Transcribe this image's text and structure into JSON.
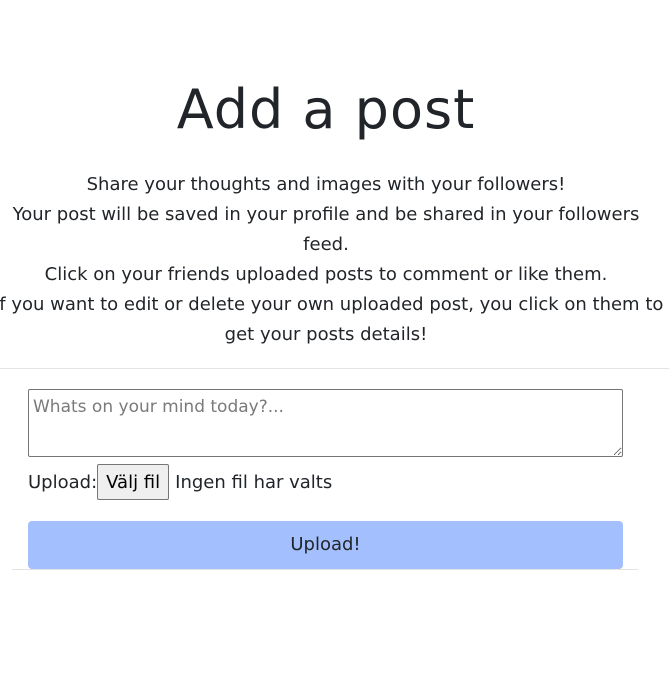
{
  "header": {
    "title": "Add a post"
  },
  "intro": {
    "lines": [
      "Share your thoughts and images with your followers!",
      "Your post will be saved in your profile and be shared in your followers",
      "feed.",
      "Click on your friends uploaded posts to comment or like them.",
      "If you want to edit or delete your own uploaded post, you click on them to",
      "get your posts details!"
    ]
  },
  "form": {
    "textarea_placeholder": "Whats on your mind today?...",
    "upload_label": "Upload:",
    "file_button_label": "Välj fil",
    "file_status": "Ingen fil har valts",
    "submit_label": "Upload!"
  },
  "colors": {
    "submit_button": "#a3bffd",
    "text": "#212529"
  }
}
